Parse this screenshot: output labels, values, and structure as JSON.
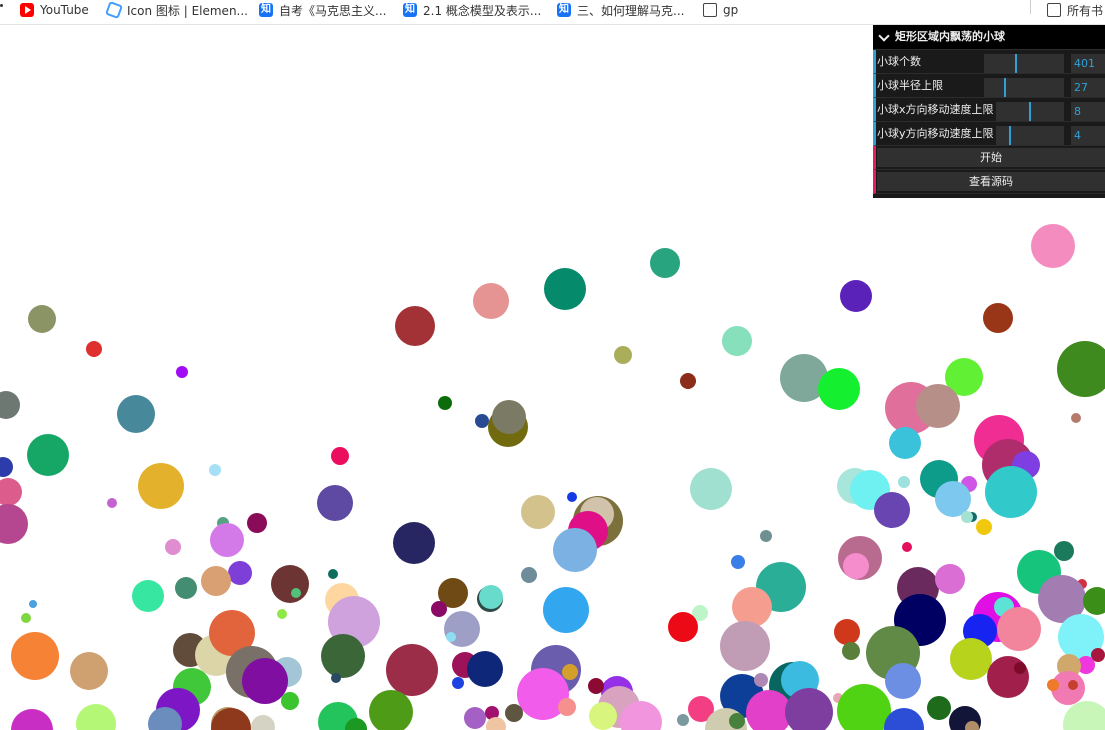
{
  "bookmarks": [
    {
      "label": "YouTube",
      "icon": "youtube-icon"
    },
    {
      "label": "Icon 图标 | Elemen...",
      "icon": "element-icon"
    },
    {
      "label": "自考《马克思主义...",
      "icon": "zhihu-icon"
    },
    {
      "label": "2.1 概念模型及表示...",
      "icon": "zhihu-icon"
    },
    {
      "label": "三、如何理解马克...",
      "icon": "zhihu-icon"
    },
    {
      "label": "gp",
      "icon": "folder-icon"
    },
    {
      "label": "所有书",
      "icon": "folder-icon"
    }
  ],
  "zhihu_glyph": "知",
  "gui": {
    "title": "矩形区域内飘荡的小球",
    "controls": [
      {
        "label": "小球个数",
        "value": "401",
        "fraction": 0.4
      },
      {
        "label": "小球半径上限",
        "value": "27",
        "fraction": 0.25
      },
      {
        "label": "小球x方向移动速度上限",
        "value": "8",
        "fraction": 0.5
      },
      {
        "label": "小球y方向移动速度上限",
        "value": "4",
        "fraction": 0.2
      }
    ],
    "buttons": [
      {
        "label": "开始"
      },
      {
        "label": "查看源码"
      }
    ]
  },
  "colors": {
    "accent_number": "#2fa1d6",
    "button_stripe": "#e61d5f",
    "gui_bg": "#1a1a1a"
  }
}
